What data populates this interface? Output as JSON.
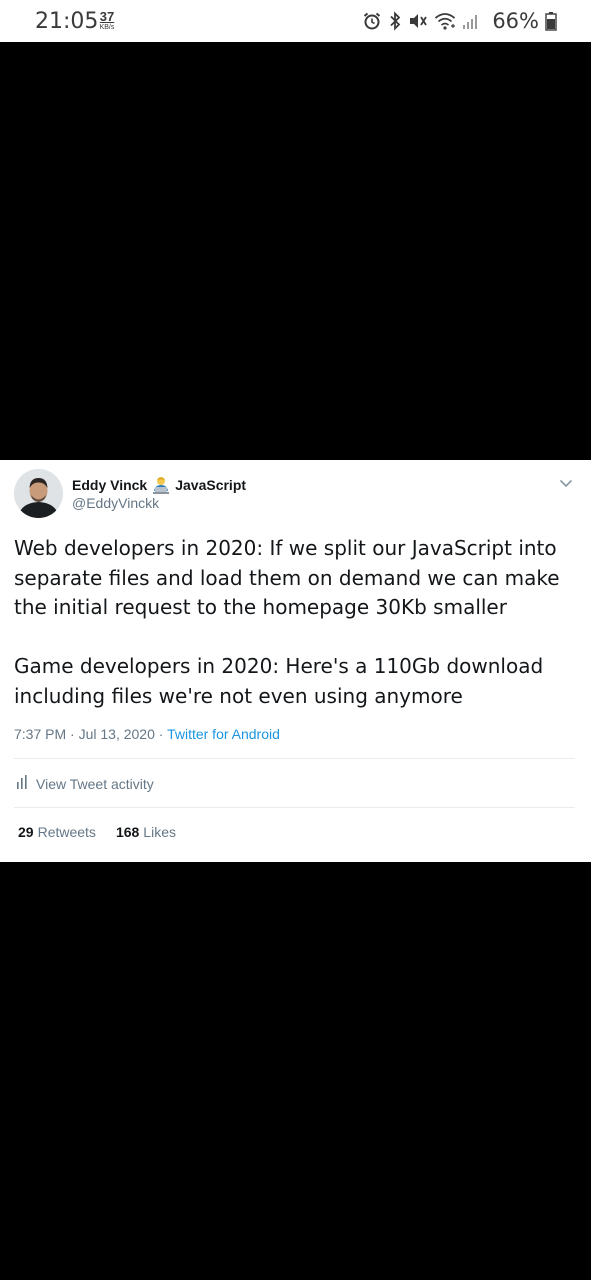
{
  "status_bar": {
    "time": "21:05",
    "net_speed_value": "37",
    "net_speed_unit": "KB/s",
    "battery_percent": "66%",
    "icons": [
      "alarm-icon",
      "bluetooth-icon",
      "mute-icon",
      "wifi-icon",
      "signal-icon",
      "battery-icon"
    ]
  },
  "tweet": {
    "display_name": "Eddy Vinck",
    "name_emoji": "technologist-emoji",
    "name_suffix": "JavaScript",
    "handle": "@EddyVinckk",
    "text_paragraph_1": "Web developers in 2020: If we split our JavaScript into separate files and load them on demand we can make the initial request to the homepage 30Kb smaller",
    "text_paragraph_2": "Game developers in 2020: Here's a 110Gb download including files we're not even using anymore",
    "timestamp": "7:37 PM · Jul 13, 2020 · ",
    "source": "Twitter for Android",
    "activity_label": "View Tweet activity",
    "retweets_count": "29",
    "retweets_label": "Retweets",
    "likes_count": "168",
    "likes_label": "Likes"
  },
  "colors": {
    "link_blue": "#1b95e0",
    "secondary_text": "#657786",
    "primary_text": "#14171a",
    "divider": "#e6ecf0"
  }
}
